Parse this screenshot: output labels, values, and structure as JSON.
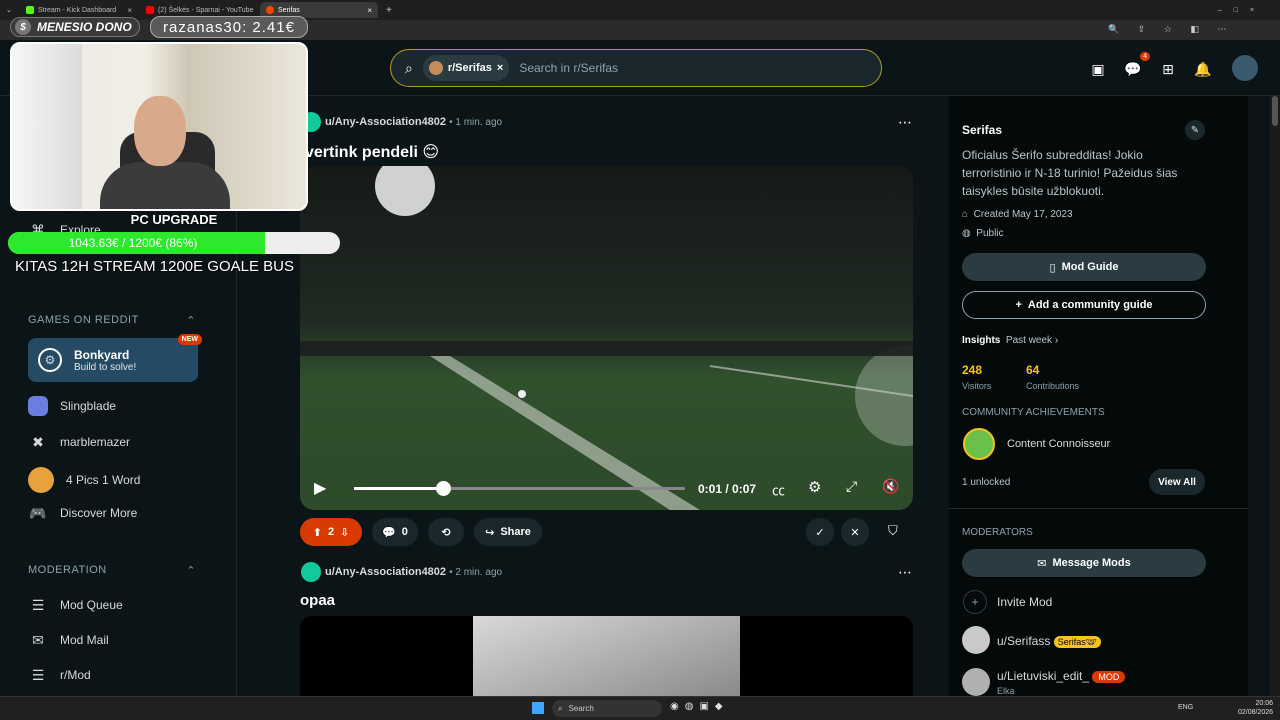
{
  "browser": {
    "tabs": [
      {
        "label": "Stream - Kick Dashboard",
        "color": "#53fc18"
      },
      {
        "label": "(2) Šelkės - Sparnai - YouTube",
        "color": "#ff0000"
      },
      {
        "label": "Serifas",
        "color": "#ff4500"
      }
    ]
  },
  "header": {
    "chip_label": "r/Serifas",
    "search_placeholder": "Search in r/Serifas",
    "notif_count": "4"
  },
  "sidebar": {
    "explore": "Explore",
    "games_head": "GAMES ON REDDIT",
    "featured_game": {
      "title": "Bonkyard",
      "subtitle": "Build to solve!",
      "badge": "NEW"
    },
    "games": [
      "Slingblade",
      "marblemazer",
      "4 Pics 1 Word",
      "Discover More"
    ],
    "moderation_head": "MODERATION",
    "mod_items": [
      "Mod Queue",
      "Mod Mail",
      "r/Mod"
    ]
  },
  "posts": [
    {
      "user": "u/Any-Association4802",
      "time": "1 min. ago",
      "title": "vertink pendeli",
      "votes": "2",
      "comments": "0",
      "share": "Share",
      "time_display": "0:01 / 0:07",
      "progress": 0.27
    },
    {
      "user": "u/Any-Association4802",
      "time": "2 min. ago",
      "title": "opaa"
    }
  ],
  "community": {
    "name": "Serifas",
    "description": "Oficialus Šerifo subredditas! Jokio terroristinio ir N-18 turinio! Pažeidus šias taisykles būsite užblokuoti.",
    "created": "Created May 17, 2023",
    "visibility": "Public",
    "mod_guide": "Mod Guide",
    "add_guide": "Add a community guide",
    "insights_label": "Insights",
    "insights_period": "Past week",
    "visitors": "248",
    "visitors_label": "Visitors",
    "contributions": "64",
    "contributions_label": "Contributions",
    "achievements_head": "COMMUNITY ACHIEVEMENTS",
    "achievement": "Content Connoisseur",
    "unlocked": "1 unlocked",
    "view_all": "View All",
    "moderators_head": "MODERATORS",
    "message_mods": "Message Mods",
    "invite_mod": "Invite Mod",
    "mods": [
      {
        "name": "u/Serifass",
        "flair": "Serifas🤓",
        "flair_color": "#f5c518"
      },
      {
        "name": "u/Lietuviski_edit_",
        "flair": "MOD",
        "flair_color": "#d93a00",
        "sub": "Elka"
      }
    ]
  },
  "stream_overlay": {
    "top_label": "MENESIO DONO",
    "donation": "razanas30: 2.41€",
    "goal_title": "PC UPGRADE",
    "goal_text": "1043.63€ / 1200€ (86%)",
    "goal_progress": 0.86,
    "ticker": "KITAS 12H STREAM 1200E GOALE BUS"
  },
  "taskbar": {
    "search": "Search",
    "lang": "ENG",
    "time": "20:06",
    "date": "02/08/2026"
  }
}
